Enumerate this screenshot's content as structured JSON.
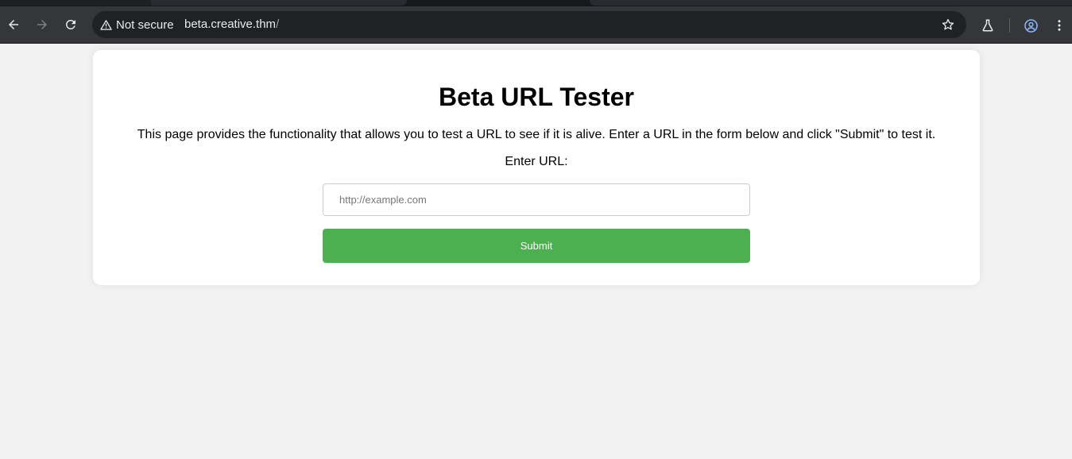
{
  "browser": {
    "security_label": "Not secure",
    "url_host": "beta.creative.thm",
    "url_path": "/"
  },
  "page": {
    "title": "Beta URL Tester",
    "description": "This page provides the functionality that allows you to test a URL to see if it is alive. Enter a URL in the form below and click \"Submit\" to test it.",
    "url_label": "Enter URL:",
    "url_input": {
      "value": "",
      "placeholder": "http://example.com"
    },
    "submit_label": "Submit"
  },
  "colors": {
    "page_background": "#f2f2f2",
    "card_background": "#ffffff",
    "submit_button": "#4caf50",
    "browser_toolbar": "#35363a",
    "omnibox": "#202124"
  },
  "icons": [
    "back-arrow-icon",
    "forward-arrow-icon",
    "reload-icon",
    "warning-icon",
    "star-icon",
    "labs-flask-icon",
    "profile-icon",
    "kebab-menu-icon"
  ]
}
